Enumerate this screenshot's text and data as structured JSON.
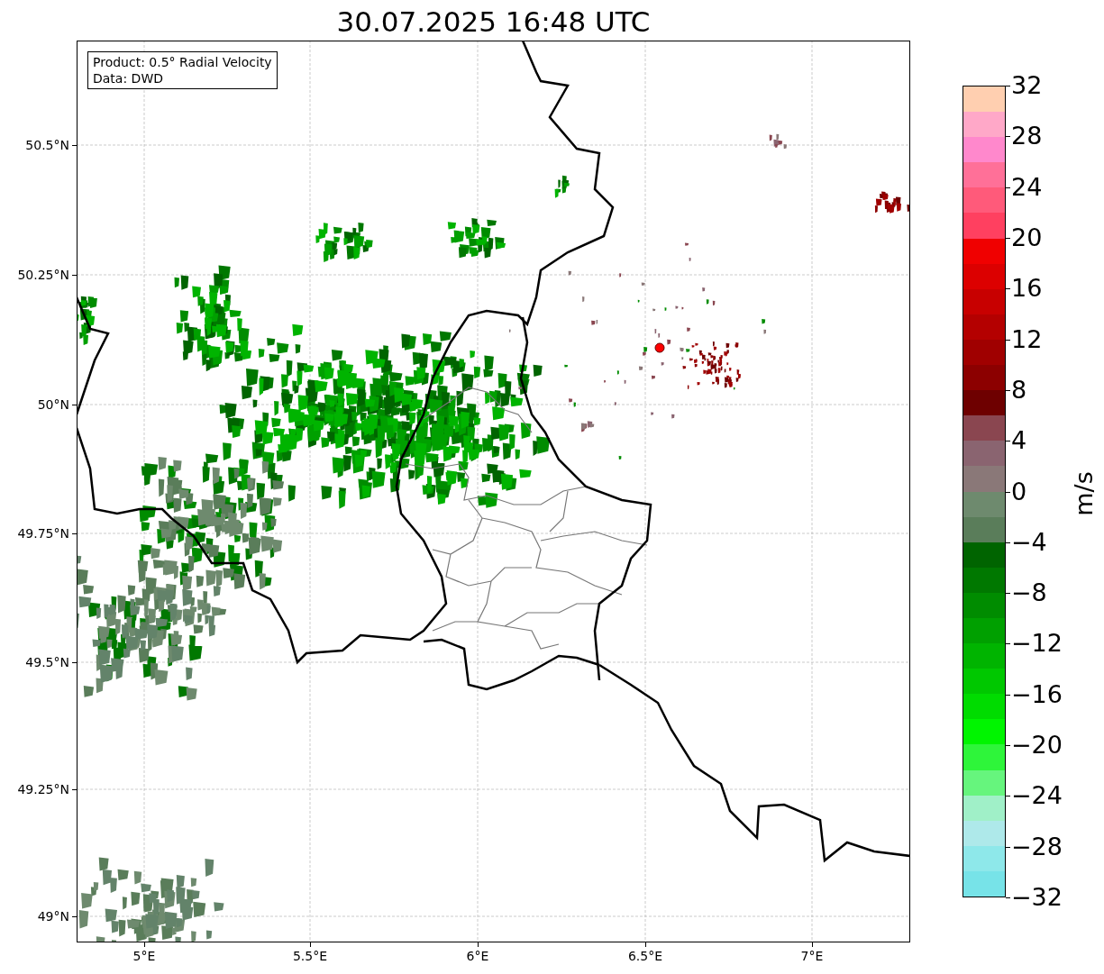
{
  "title": "30.07.2025 16:48 UTC",
  "info_box": [
    "Product: 0.5° Radial Velocity",
    "Data: DWD"
  ],
  "map": {
    "lat_ticks": [
      "50.5°N",
      "50.25°N",
      "50°N",
      "49.75°N",
      "49.5°N",
      "49.25°N",
      "49°N"
    ],
    "lon_ticks": [
      "5°E",
      "5.5°E",
      "6°E",
      "6.5°E",
      "7°E"
    ]
  },
  "colorbar": {
    "label": "m/s",
    "ticks": [
      "32",
      "28",
      "24",
      "20",
      "16",
      "12",
      "8",
      "4",
      "0",
      "−4",
      "−8",
      "−12",
      "−16",
      "−20",
      "−24",
      "−28",
      "−32"
    ],
    "bins": [
      {
        "color": "#ffcfb0"
      },
      {
        "color": "#ffa8c8"
      },
      {
        "color": "#ff88cc"
      },
      {
        "color": "#ff7098"
      },
      {
        "color": "#ff5a7a"
      },
      {
        "color": "#ff4060"
      },
      {
        "color": "#f00000"
      },
      {
        "color": "#dc0000"
      },
      {
        "color": "#c80000"
      },
      {
        "color": "#b40000"
      },
      {
        "color": "#a00000"
      },
      {
        "color": "#8c0000"
      },
      {
        "color": "#6e0000"
      },
      {
        "color": "#8a4650"
      },
      {
        "color": "#8a6470"
      },
      {
        "color": "#8a7878"
      },
      {
        "color": "#6e8a6e"
      },
      {
        "color": "#5a7d5a"
      },
      {
        "color": "#006400"
      },
      {
        "color": "#007800"
      },
      {
        "color": "#008c00"
      },
      {
        "color": "#00a000"
      },
      {
        "color": "#00b400"
      },
      {
        "color": "#00c800"
      },
      {
        "color": "#00dc00"
      },
      {
        "color": "#00f500"
      },
      {
        "color": "#2ef53a"
      },
      {
        "color": "#66f57d"
      },
      {
        "color": "#a0f0c8"
      },
      {
        "color": "#aee9ea"
      },
      {
        "color": "#8ee8ea"
      },
      {
        "color": "#77e3e8"
      }
    ]
  }
}
